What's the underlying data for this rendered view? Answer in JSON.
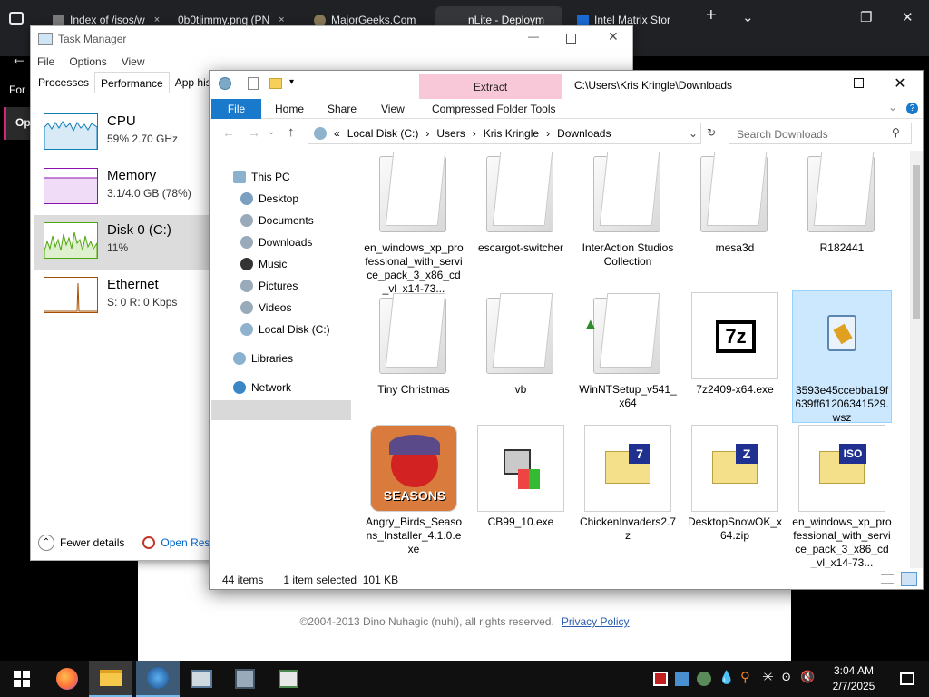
{
  "browser": {
    "tabs": [
      {
        "label": "Index of /isos/w",
        "color": "#7a7a7a"
      },
      {
        "label": "0b0tjimmy.png (PN",
        "color": "#7a7a7a"
      },
      {
        "label": "MajorGeeks.Com",
        "color": "#8a7a5a"
      },
      {
        "label": "nLite - Deploym",
        "color": "#5a5a5a"
      },
      {
        "label": "Intel Matrix Stor",
        "color": "#1a6bd6"
      }
    ],
    "close_glyph": "×",
    "new_tab_glyph": "+",
    "left_text": "For",
    "left_btn": "Op"
  },
  "task_manager": {
    "title": "Task Manager",
    "menu": [
      "File",
      "Options",
      "View"
    ],
    "tabs": [
      "Processes",
      "Performance",
      "App hist"
    ],
    "items": [
      {
        "name": "CPU",
        "value": "59% 2.70 GHz",
        "color": "#117dbb"
      },
      {
        "name": "Memory",
        "value": "3.1/4.0 GB (78%)",
        "color": "#8b12ae"
      },
      {
        "name": "Disk 0 (C:)",
        "value": "11%",
        "color": "#4da60c"
      },
      {
        "name": "Ethernet",
        "value": "S: 0 R: 0 Kbps",
        "color": "#a74f01"
      }
    ],
    "fewer": "Fewer details",
    "open_res": "Open Reso"
  },
  "explorer": {
    "context_tab": "Extract",
    "path_title": "C:\\Users\\Kris Kringle\\Downloads",
    "ribbon": [
      "File",
      "Home",
      "Share",
      "View",
      "Compressed Folder Tools"
    ],
    "address": [
      "«",
      "Local Disk (C:)",
      "›",
      "Users",
      "›",
      "Kris Kringle",
      "›",
      "Downloads"
    ],
    "search_placeholder": "Search Downloads",
    "nav": [
      "This PC",
      "Desktop",
      "Documents",
      "Downloads",
      "Music",
      "Pictures",
      "Videos",
      "Local Disk (C:)",
      "Libraries",
      "Network"
    ],
    "files": [
      {
        "name": "en_windows_xp_professional_with_service_pack_3_x86_cd_vl_x14-73...",
        "kind": "folder"
      },
      {
        "name": "escargot-switcher",
        "kind": "folder"
      },
      {
        "name": "InterAction Studios Collection",
        "kind": "folder"
      },
      {
        "name": "mesa3d",
        "kind": "folder-text"
      },
      {
        "name": "R182441",
        "kind": "folder"
      },
      {
        "name": "Tiny Christmas",
        "kind": "folder"
      },
      {
        "name": "vb",
        "kind": "folder"
      },
      {
        "name": "WinNTSetup_v541_x64",
        "kind": "folder-text"
      },
      {
        "name": "7z2409-x64.exe",
        "kind": "exe7z"
      },
      {
        "name": "3593e45ccebba19f639ff61206341529.wsz",
        "kind": "wsz"
      },
      {
        "name": "Angry_Birds_Seasons_Installer_4.1.0.exe",
        "kind": "angry"
      },
      {
        "name": "CB99_10.exe",
        "kind": "setup"
      },
      {
        "name": "ChickenInvaders2.7z",
        "kind": "zip7"
      },
      {
        "name": "DesktopSnowOK_x64.zip",
        "kind": "zipz"
      },
      {
        "name": "en_windows_xp_professional_with_service_pack_3_x86_cd_vl_x14-73...",
        "kind": "iso"
      }
    ],
    "angry_label": "SEASONS",
    "status": {
      "count": "44 items",
      "selection": "1 item selected  101 KB"
    }
  },
  "website": {
    "copyright": "©2004-2013 Dino Nuhagic (nuhi), all rights reserved.",
    "link": "Privacy Policy"
  },
  "taskbar": {
    "time": "3:04 AM",
    "date": "2/7/2025"
  }
}
